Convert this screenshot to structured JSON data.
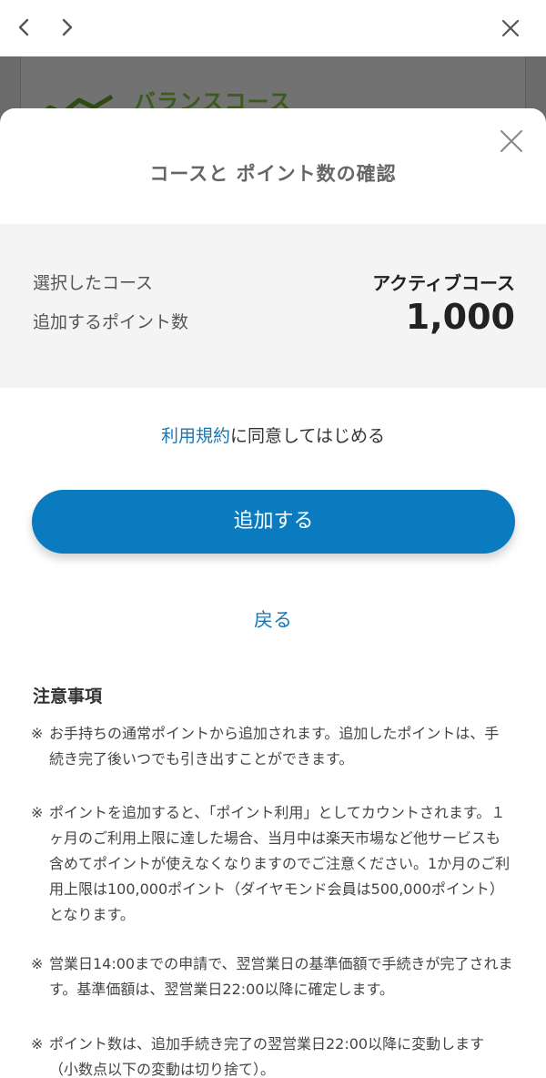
{
  "browser": {
    "back_icon": "chevron-left-icon",
    "forward_icon": "chevron-right-icon",
    "close_icon": "close-icon"
  },
  "background_page": {
    "course_title": "バランスコース",
    "course_icon": "line-chart-icon"
  },
  "dialog": {
    "title": "コースと ポイント数の確認",
    "close_icon": "close-icon",
    "summary": {
      "course_label": "選択したコース",
      "course_value": "アクティブコース",
      "points_label": "追加するポイント数",
      "points_value": "1,000"
    },
    "terms": {
      "link_text": "利用規約",
      "suffix_text": "に同意してはじめる"
    },
    "add_button_label": "追加する",
    "back_link_label": "戻る",
    "notes": {
      "heading": "注意事項",
      "mark": "※",
      "items": [
        "お手持ちの通常ポイントから追加されます。追加したポイントは、手続き完了後いつでも引き出すことができます。",
        "ポイントを追加すると、「ポイント利用」としてカウントされます。１ヶ月のご利用上限に達した場合、当月中は楽天市場など他サービスも含めてポイントが使えなくなりますのでご注意ください。1か月のご利用上限は100,000ポイント（ダイヤモンド会員は500,000ポイント）となります。",
        "営業日14:00までの申請で、翌営業日の基準価額で手続きが完了されます。基準価額は、翌営業日22:00以降に確定します。",
        "ポイント数は、追加手続き完了の翌営業日22:00以降に変動します（小数点以下の変動は切り捨て）。"
      ]
    }
  },
  "colors": {
    "accent": "#0a7bbf",
    "link": "#1777b6",
    "backdrop": "#6b6b6b",
    "summary_bg": "#f4f4f4"
  }
}
